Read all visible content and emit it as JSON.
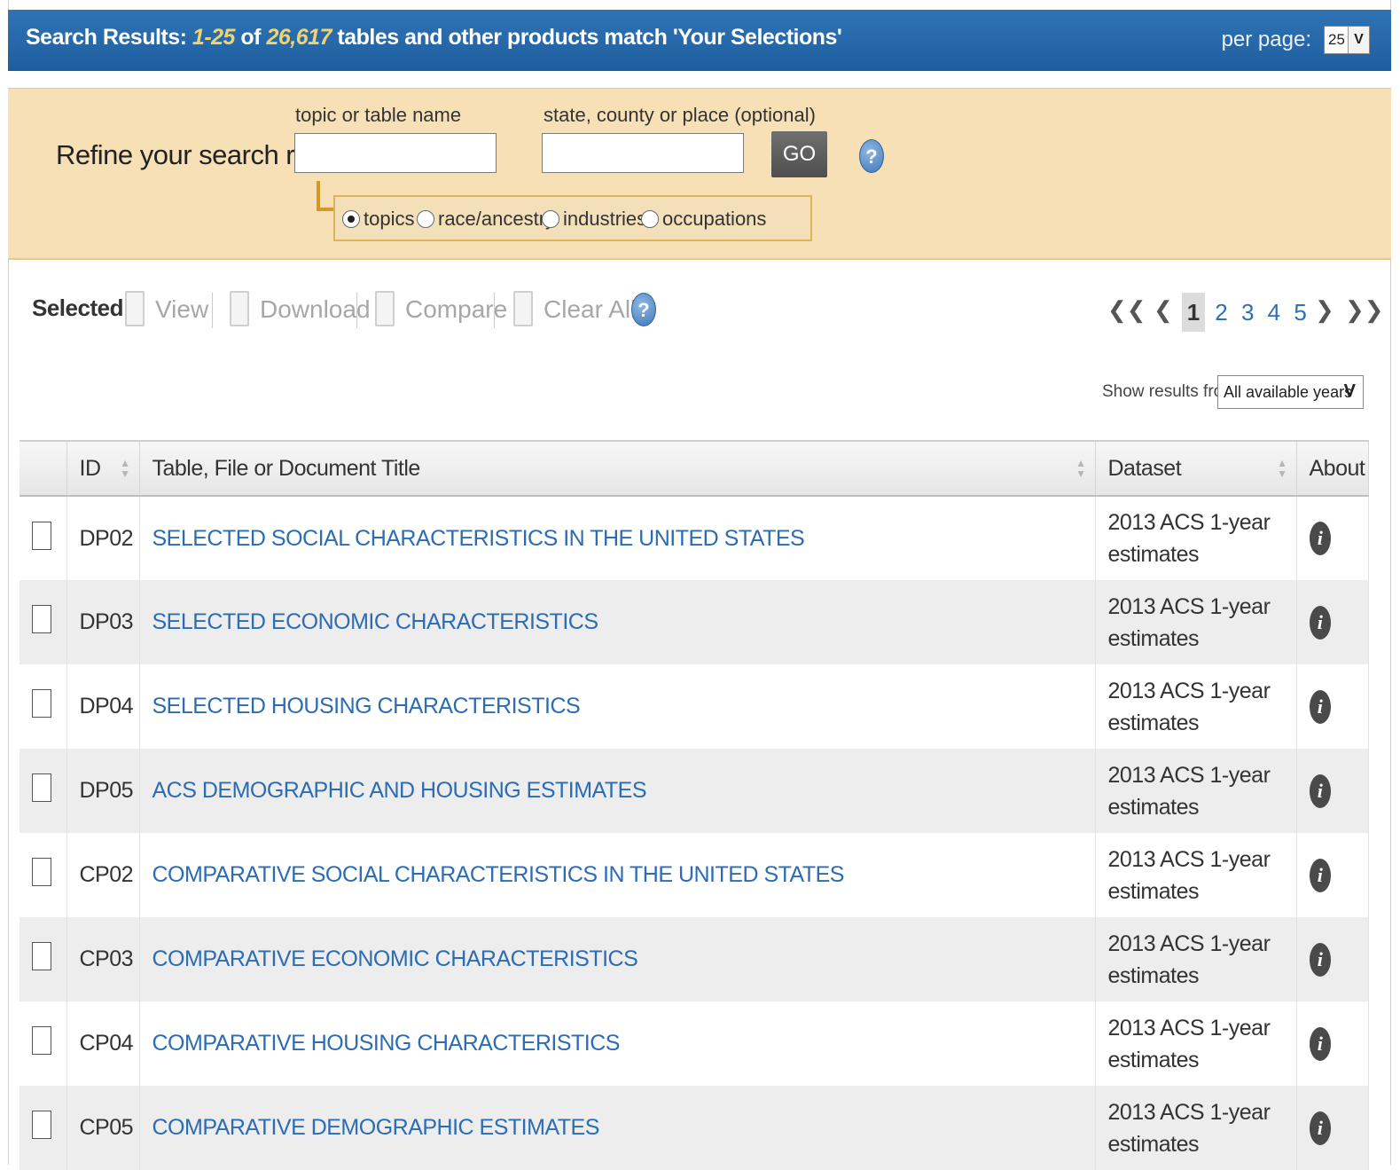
{
  "header": {
    "prefix": "Search Results: ",
    "range": "1-25",
    "of": " of ",
    "total": "26,617",
    "suffix": " tables and other products match 'Your Selections'",
    "per_page_label": "per page:",
    "per_page_value": "25"
  },
  "refine": {
    "label": "Refine your search results:",
    "topic_label": "topic or table name",
    "place_label": "state, county or place (optional)",
    "topic_value": "",
    "place_value": "",
    "go_label": "GO",
    "radios": [
      {
        "label": "topics",
        "selected": true
      },
      {
        "label": "race/ancestry",
        "selected": false
      },
      {
        "label": "industries",
        "selected": false
      },
      {
        "label": "occupations",
        "selected": false
      }
    ]
  },
  "toolbar": {
    "selected_label": "Selected:",
    "view": "View",
    "download": "Download",
    "compare": "Compare",
    "clear_all": "Clear All"
  },
  "pager": {
    "current": "1",
    "pages": [
      "2",
      "3",
      "4",
      "5"
    ]
  },
  "filter": {
    "label": "Show results from:",
    "value": "All available years"
  },
  "table": {
    "columns": [
      "ID",
      "Table, File or Document Title",
      "Dataset",
      "About"
    ],
    "rows": [
      {
        "id": "DP02",
        "title": "SELECTED SOCIAL CHARACTERISTICS IN THE UNITED STATES",
        "dataset_1": "2013 ACS 1-year",
        "dataset_2": "estimates"
      },
      {
        "id": "DP03",
        "title": "SELECTED ECONOMIC CHARACTERISTICS",
        "dataset_1": "2013 ACS 1-year",
        "dataset_2": "estimates"
      },
      {
        "id": "DP04",
        "title": "SELECTED HOUSING CHARACTERISTICS",
        "dataset_1": "2013 ACS 1-year",
        "dataset_2": "estimates"
      },
      {
        "id": "DP05",
        "title": "ACS DEMOGRAPHIC AND HOUSING ESTIMATES",
        "dataset_1": "2013 ACS 1-year",
        "dataset_2": "estimates"
      },
      {
        "id": "CP02",
        "title": "COMPARATIVE SOCIAL CHARACTERISTICS IN THE UNITED STATES",
        "dataset_1": "2013 ACS 1-year",
        "dataset_2": "estimates"
      },
      {
        "id": "CP03",
        "title": "COMPARATIVE ECONOMIC CHARACTERISTICS",
        "dataset_1": "2013 ACS 1-year",
        "dataset_2": "estimates"
      },
      {
        "id": "CP04",
        "title": "COMPARATIVE HOUSING CHARACTERISTICS",
        "dataset_1": "2013 ACS 1-year",
        "dataset_2": "estimates"
      },
      {
        "id": "CP05",
        "title": "COMPARATIVE DEMOGRAPHIC ESTIMATES",
        "dataset_1": "2013 ACS 1-year",
        "dataset_2": "estimates"
      }
    ]
  },
  "colors": {
    "header_bg": "#1f5e9e",
    "highlight": "#f0d36e",
    "refine_bg": "#f7e0b6",
    "link": "#2b6cb4"
  }
}
